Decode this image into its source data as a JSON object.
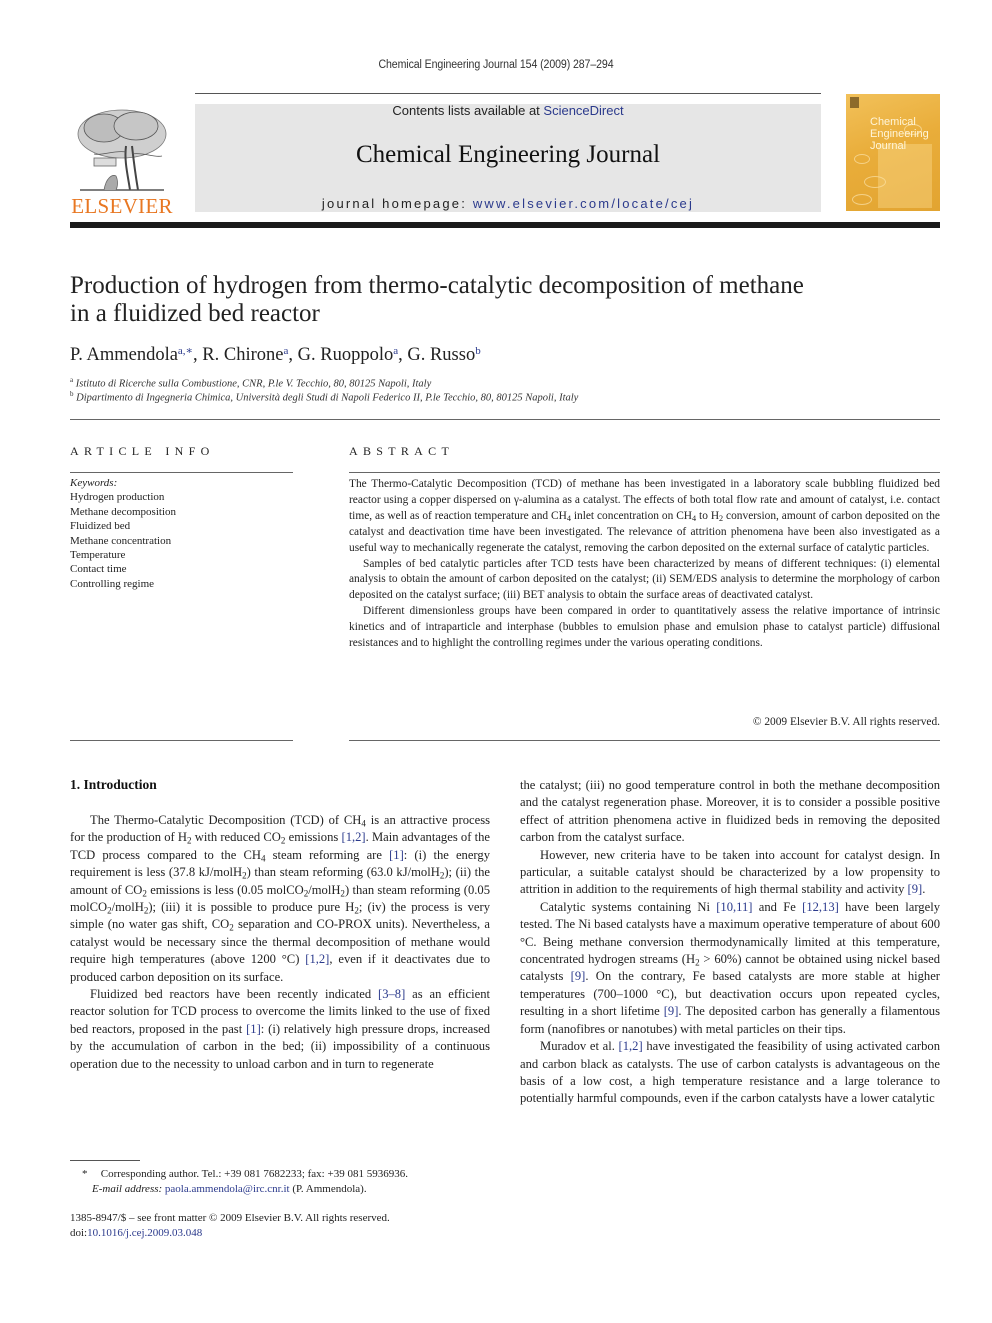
{
  "header": {
    "running_head": "Chemical Engineering Journal 154 (2009) 287–294",
    "contents_prefix": "Contents lists available at ",
    "contents_link": "ScienceDirect",
    "journal_name": "Chemical Engineering Journal",
    "homepage_prefix": "journal homepage: ",
    "homepage_link": "www.elsevier.com/locate/cej",
    "publisher_logo": "ELSEVIER",
    "cover_title_lines": [
      "Chemical",
      "Engineering",
      "Journal"
    ],
    "colors": {
      "elsevier_orange": "#e87722",
      "link_blue": "#2b3a8c",
      "cover_gold": "#e9ad3a",
      "masthead_gray": "#e6e6e6"
    }
  },
  "article": {
    "title_line1": "Production of hydrogen from thermo-catalytic decomposition of methane",
    "title_line2": "in a fluidized bed reactor",
    "authors": [
      {
        "name": "P. Ammendola",
        "sup": "a,∗"
      },
      {
        "name": "R. Chirone",
        "sup": "a"
      },
      {
        "name": "G. Ruoppolo",
        "sup": "a"
      },
      {
        "name": "G. Russo",
        "sup": "b"
      }
    ],
    "affiliations": [
      {
        "mark": "a",
        "text": "Istituto di Ricerche sulla Combustione, CNR, P.le V. Tecchio, 80, 80125 Napoli, Italy"
      },
      {
        "mark": "b",
        "text": "Dipartimento di Ingegneria Chimica, Università degli Studi di Napoli Federico II, P.le Tecchio, 80, 80125 Napoli, Italy"
      }
    ]
  },
  "article_info": {
    "heading": "ARTICLE INFO",
    "keywords_label": "Keywords:",
    "keywords": [
      "Hydrogen production",
      "Methane decomposition",
      "Fluidized bed",
      "Methane concentration",
      "Temperature",
      "Contact time",
      "Controlling regime"
    ]
  },
  "abstract": {
    "heading": "ABSTRACT",
    "p1_a": "The Thermo-Catalytic Decomposition (TCD) of methane has been investigated in a laboratory scale bubbling fluidized bed reactor using a copper dispersed on γ-alumina as a catalyst. The effects of both total flow rate and amount of catalyst, i.e. contact time, as well as of reaction temperature and CH",
    "p1_b": " inlet concentration on CH",
    "p1_c": " to H",
    "p1_d": " conversion, amount of carbon deposited on the catalyst and deactivation time have been investigated. The relevance of attrition phenomena have been also investigated as a useful way to mechanically regenerate the catalyst, removing the carbon deposited on the external surface of catalytic particles.",
    "p2": "Samples of bed catalytic particles after TCD tests have been characterized by means of different techniques: (i) elemental analysis to obtain the amount of carbon deposited on the catalyst; (ii) SEM/EDS analysis to determine the morphology of carbon deposited on the catalyst surface; (iii) BET analysis to obtain the surface areas of deactivated catalyst.",
    "p3": "Different dimensionless groups have been compared in order to quantitatively assess the relative importance of intrinsic kinetics and of intraparticle and interphase (bubbles to emulsion phase and emulsion phase to catalyst particle) diffusional resistances and to highlight the controlling regimes under the various operating conditions.",
    "copyright": "© 2009 Elsevier B.V. All rights reserved."
  },
  "body": {
    "section_heading": "1.  Introduction",
    "left": {
      "p1": [
        "The Thermo-Catalytic Decomposition (TCD) of CH",
        "4",
        " is an attractive process for the production of H",
        "2",
        " with reduced CO",
        "2",
        " emissions ",
        "[1,2]",
        ". Main advantages of the TCD process compared to the CH",
        "4",
        " steam reforming are ",
        "[1]",
        ": (i) the energy requirement is less (37.8 kJ/molH",
        "2",
        ") than steam reforming (63.0 kJ/molH",
        "2",
        "); (ii) the amount of CO",
        "2",
        " emissions is less (0.05 molCO",
        "2",
        "/molH",
        "2",
        ") than steam reforming (0.05 molCO",
        "2",
        "/molH",
        "2",
        "); (iii) it is possible to produce pure H",
        "2",
        "; (iv) the process is very simple (no water gas shift, CO",
        "2",
        " separation and CO-PROX units). Nevertheless, a catalyst would be necessary since the thermal decomposition of methane would require high temperatures (above 1200 °C) ",
        "[1,2]",
        ", even if it deactivates due to produced carbon deposition on its surface."
      ],
      "p2_a": "Fluidized bed reactors have been recently indicated ",
      "p2_ref1": "[3–8]",
      "p2_b": " as an efficient reactor solution for TCD process to overcome the limits linked to the use of fixed bed reactors, proposed in the past ",
      "p2_ref2": "[1]",
      "p2_c": ": (i) relatively high pressure drops, increased by the accumulation of carbon in the bed; (ii) impossibility of a continuous operation due to the necessity to unload carbon and in turn to regenerate"
    },
    "right": {
      "p1": "the catalyst; (iii) no good temperature control in both the methane decomposition and the catalyst regeneration phase. Moreover, it is to consider a possible positive effect of attrition phenomena active in fluidized beds in removing the deposited carbon from the catalyst surface.",
      "p2_a": "However, new criteria have to be taken into account for catalyst design. In particular, a suitable catalyst should be characterized by a low propensity to attrition in addition to the requirements of high thermal stability and activity ",
      "p2_ref": "[9]",
      "p2_b": ".",
      "p3_a": "Catalytic systems containing Ni ",
      "p3_ref1": "[10,11]",
      "p3_b": " and Fe ",
      "p3_ref2": "[12,13]",
      "p3_c": " have been largely tested. The Ni based catalysts have a maximum operative temperature of about 600 °C. Being methane conversion thermodynamically limited at this temperature, concentrated hydrogen streams (H",
      "p3_sub": "2",
      "p3_d": " > 60%) cannot be obtained using nickel based catalysts ",
      "p3_ref3": "[9]",
      "p3_e": ". On the contrary, Fe based catalysts are more stable at higher temperatures (700–1000 °C), but deactivation occurs upon repeated cycles, resulting in a short lifetime ",
      "p3_ref4": "[9]",
      "p3_f": ". The deposited carbon has generally a filamentous form (nanofibres or nanotubes) with metal particles on their tips.",
      "p4_a": "Muradov et al. ",
      "p4_ref": "[1,2]",
      "p4_b": " have investigated the feasibility of using activated carbon and carbon black as catalysts. The use of carbon catalysts is advantageous on the basis of a low cost, a high temperature resistance and a large tolerance to potentially harmful compounds, even if the carbon catalysts have a lower catalytic"
    }
  },
  "footnote": {
    "star": "*",
    "corresponding": "Corresponding author. Tel.: +39 081 7682233; fax: +39 081 5936936.",
    "email_label": "E-mail address:",
    "email": "paola.ammendola@irc.cnr.it",
    "email_suffix": " (P. Ammendola).",
    "front_matter": "1385-8947/$ – see front matter © 2009 Elsevier B.V. All rights reserved.",
    "doi_label": "doi:",
    "doi": "10.1016/j.cej.2009.03.048"
  }
}
